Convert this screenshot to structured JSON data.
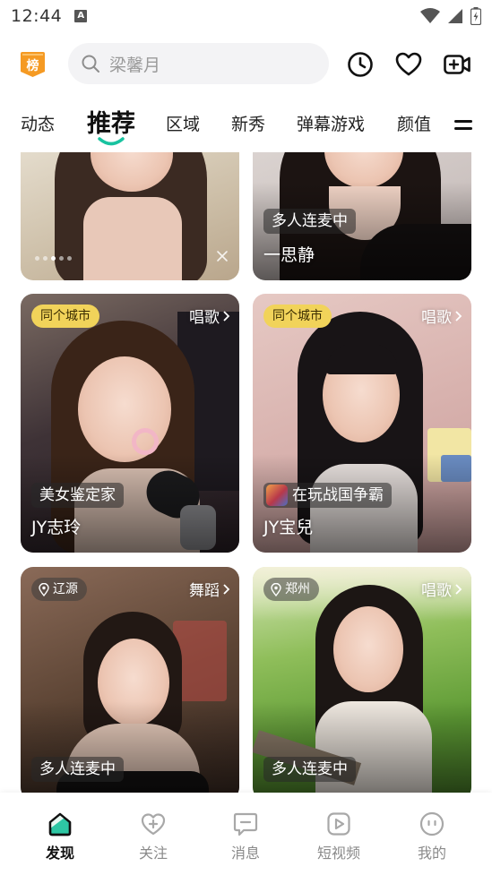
{
  "status_bar": {
    "time": "12:44",
    "notification_icon": "a-notification-icon",
    "icons": [
      "wifi-icon",
      "signal-icon",
      "battery-icon"
    ]
  },
  "header": {
    "rank_badge_label": "榜",
    "search_placeholder": "梁馨月",
    "icons": [
      "history-clock-icon",
      "favorites-heart-icon",
      "go-live-camera-icon"
    ]
  },
  "tabs": [
    {
      "label": "动态",
      "active": false
    },
    {
      "label": "推荐",
      "active": true
    },
    {
      "label": "区域",
      "active": false
    },
    {
      "label": "新秀",
      "active": false
    },
    {
      "label": "弹幕游戏",
      "active": false
    },
    {
      "label": "颜值",
      "active": false
    }
  ],
  "feed": {
    "cards": [
      {
        "name": "",
        "tag": "",
        "carousel_dots": 5,
        "carousel_active": 2
      },
      {
        "name": "一思静",
        "tag": "多人连麦中"
      },
      {
        "name": "JY志玲",
        "tag": "美女鉴定家",
        "badge": "同个城市",
        "category": "唱歌"
      },
      {
        "name": "JY宝兒",
        "tag": "在玩战国争霸",
        "badge": "同个城市",
        "category": "唱歌"
      },
      {
        "name": "",
        "tag": "多人连麦中",
        "location": "辽源",
        "category": "舞蹈"
      },
      {
        "name": "",
        "tag": "多人连麦中",
        "location": "郑州",
        "category": "唱歌"
      }
    ]
  },
  "bottom_nav": [
    {
      "label": "发现",
      "icon": "discover-home-icon",
      "active": true
    },
    {
      "label": "关注",
      "icon": "follow-heart-icon",
      "active": false
    },
    {
      "label": "消息",
      "icon": "message-bubble-icon",
      "active": false
    },
    {
      "label": "短视频",
      "icon": "short-video-play-icon",
      "active": false
    },
    {
      "label": "我的",
      "icon": "profile-face-icon",
      "active": false
    }
  ],
  "colors": {
    "accent_green": "#19c3a0",
    "rank_badge_orange": "#f59a23",
    "city_badge_yellow": "#f1d35a"
  }
}
